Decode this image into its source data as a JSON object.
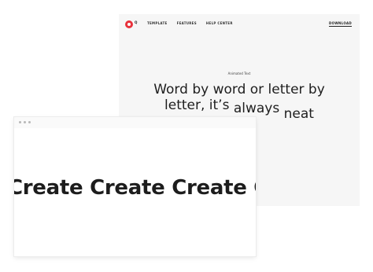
{
  "back_window": {
    "brand": "Q",
    "nav": [
      "TEMPLATE",
      "FEATURES",
      "HELP CENTER"
    ],
    "download_label": "DOWNLOAD",
    "hero": {
      "eyebrow": "Animated Text",
      "line1": "Word by word or letter by",
      "line2_a": "letter, it’s",
      "line2_b": "always",
      "line2_c": "neat"
    }
  },
  "front_window": {
    "marquee": "Create Create Create Create"
  },
  "colors": {
    "brand_red": "#e8313b",
    "back_bg": "#f6f6f6",
    "text": "#1e1e1e"
  }
}
